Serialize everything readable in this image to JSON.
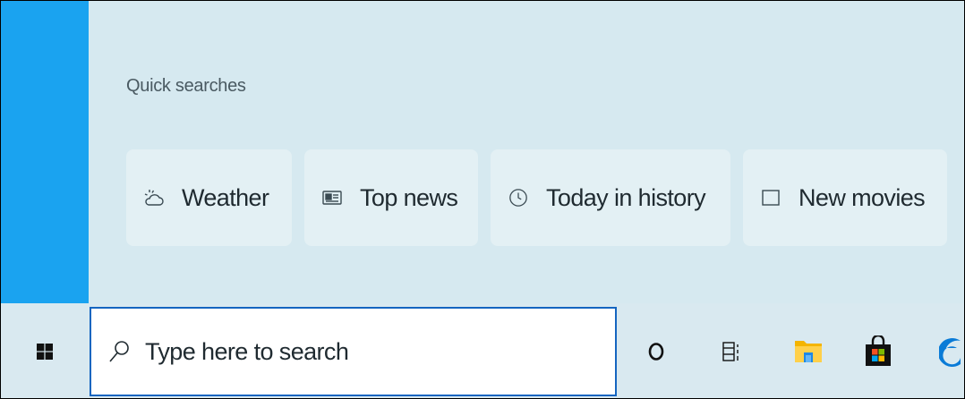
{
  "quick_searches": {
    "title": "Quick searches",
    "items": [
      {
        "label": "Weather",
        "icon": "weather-icon"
      },
      {
        "label": "Top news",
        "icon": "news-icon"
      },
      {
        "label": "Today in history",
        "icon": "clock-icon"
      },
      {
        "label": "New movies",
        "icon": "movie-icon"
      }
    ]
  },
  "taskbar": {
    "search_placeholder": "Type here to search",
    "icons": [
      "windows-logo-icon",
      "cortana-icon",
      "task-view-icon",
      "file-explorer-icon",
      "microsoft-store-icon",
      "edge-icon"
    ]
  },
  "colors": {
    "accent": "#1aa3f0",
    "panel": "#d6e9f0",
    "search_border": "#1565c0"
  }
}
